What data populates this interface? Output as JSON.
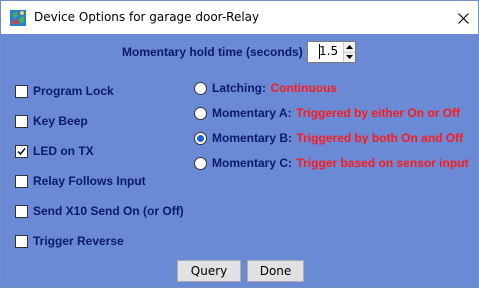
{
  "window": {
    "title": "Device Options for garage door-Relay"
  },
  "hold_time": {
    "label": "Momentary hold time (seconds)",
    "value": "1.5"
  },
  "checkboxes": [
    {
      "label": "Program Lock",
      "checked": false
    },
    {
      "label": "Key Beep",
      "checked": false
    },
    {
      "label": "LED on TX",
      "checked": true
    },
    {
      "label": "Relay Follows Input",
      "checked": false
    },
    {
      "label": "Send X10 Send On (or Off)",
      "checked": false
    },
    {
      "label": "Trigger Reverse",
      "checked": false
    }
  ],
  "modes": [
    {
      "label": "Latching:",
      "desc": "Continuous",
      "selected": false
    },
    {
      "label": "Momentary A:",
      "desc": "Triggered by either On or Off",
      "selected": false
    },
    {
      "label": "Momentary B:",
      "desc": "Triggered by both On and Off",
      "selected": true
    },
    {
      "label": "Momentary C:",
      "desc": "Trigger based on sensor input",
      "selected": false
    }
  ],
  "buttons": {
    "query": "Query",
    "done": "Done"
  },
  "colors": {
    "background": "#6a8ad6",
    "label": "#0b1a6b",
    "accent_red": "#ff1a1a",
    "radio_selected": "#1a63d6"
  }
}
